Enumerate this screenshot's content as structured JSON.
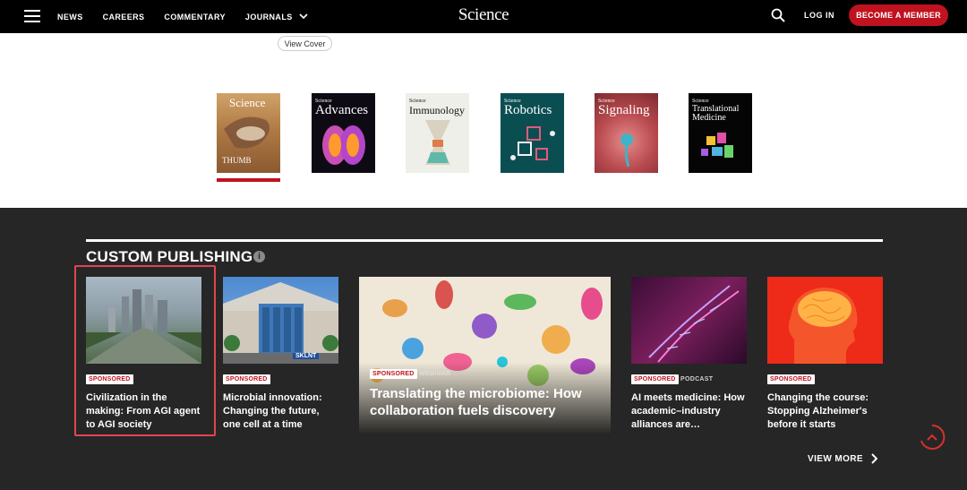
{
  "header": {
    "menu_icon": "hamburger-icon",
    "nav": [
      "NEWS",
      "CAREERS",
      "COMMENTARY",
      "JOURNALS"
    ],
    "logo": "Science",
    "search_icon": "search-icon",
    "login": "LOG IN",
    "member_button": "BECOME A MEMBER",
    "accent_color": "#c1121f"
  },
  "covers": {
    "view_cover": "View Cover",
    "journals": [
      {
        "small": "",
        "title": "Science",
        "selected": true
      },
      {
        "small": "Science",
        "title": "Advances"
      },
      {
        "small": "Science",
        "title": "Immunology"
      },
      {
        "small": "Science",
        "title": "Robotics"
      },
      {
        "small": "Science",
        "title": "Signaling"
      },
      {
        "small": "Science",
        "title": "Translational Medicine"
      }
    ],
    "science_cover_caption": "THUMB"
  },
  "custom_publishing": {
    "title": "CUSTOM PUBLISHING",
    "info_icon": "info-icon",
    "cards": [
      {
        "badge": "SPONSORED",
        "kind": "",
        "title": "Civilization in the making: From AGI agent to AGI society"
      },
      {
        "badge": "SPONSORED",
        "kind": "",
        "title": "Microbial innovation: Changing the future, one cell at a time"
      },
      {
        "badge": "SPONSORED",
        "kind": "WEBINAR",
        "title": "Translating the microbiome: How collaboration fuels discovery"
      },
      {
        "badge": "SPONSORED",
        "kind": "PODCAST",
        "title": "AI meets medicine: How academic–industry alliances are…"
      },
      {
        "badge": "SPONSORED",
        "kind": "",
        "title": "Changing the course: Stopping Alzheimer's before it starts"
      }
    ],
    "building_sign": "SKLNT",
    "view_more": "VIEW MORE"
  }
}
